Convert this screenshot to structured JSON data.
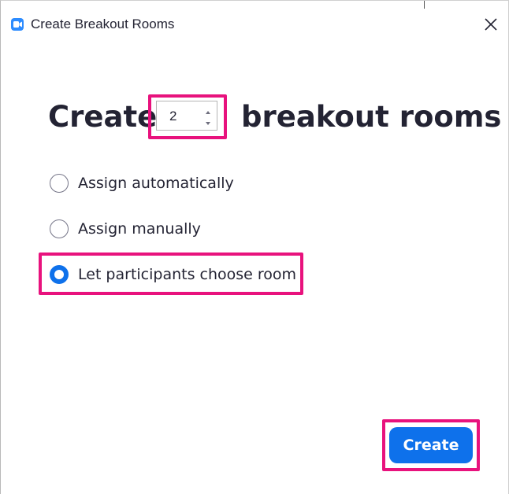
{
  "window": {
    "title": "Create Breakout Rooms",
    "accent_color": "#0e71eb",
    "highlight_color": "#e8127d"
  },
  "heading": {
    "before": "Create",
    "after": "breakout rooms"
  },
  "room_count": {
    "value": "2"
  },
  "options": [
    {
      "label": "Assign automatically",
      "checked": false
    },
    {
      "label": "Assign manually",
      "checked": false
    },
    {
      "label": "Let participants choose room",
      "checked": true
    }
  ],
  "actions": {
    "create_label": "Create"
  },
  "icons": {
    "app": "zoom-camera-icon",
    "close": "close-icon",
    "increment": "chevron-up-icon",
    "decrement": "chevron-down-icon"
  }
}
